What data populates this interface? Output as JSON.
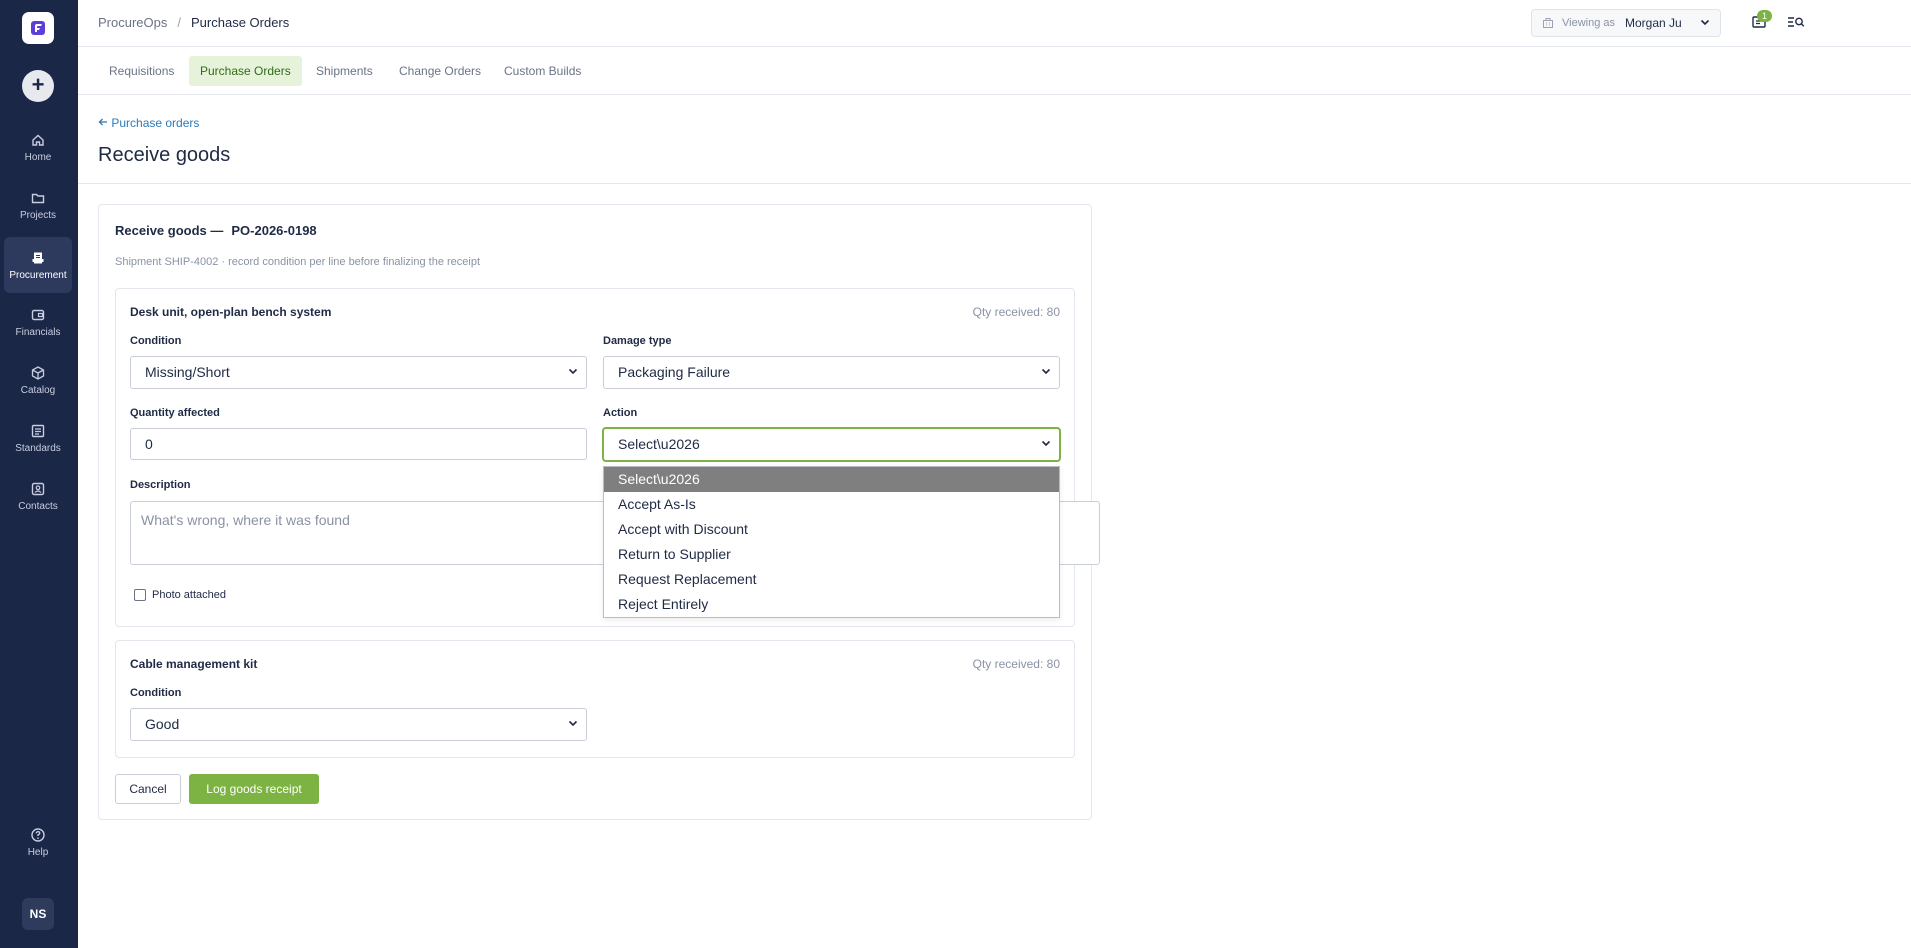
{
  "sidebar": {
    "items": [
      {
        "label": "Home",
        "icon": "home-icon"
      },
      {
        "label": "Projects",
        "icon": "folder-icon"
      },
      {
        "label": "Procurement",
        "icon": "procurement-icon"
      },
      {
        "label": "Financials",
        "icon": "wallet-icon"
      },
      {
        "label": "Catalog",
        "icon": "cube-icon"
      },
      {
        "label": "Standards",
        "icon": "list-icon"
      },
      {
        "label": "Contacts",
        "icon": "contact-card-icon"
      }
    ],
    "help": {
      "label": "Help",
      "icon": "help-icon"
    },
    "user_initials": "NS",
    "active": "Procurement"
  },
  "topbar": {
    "app": "ProcureOps",
    "separator": "/",
    "section": "Purchase Orders",
    "viewing_as_label": "Viewing as",
    "viewing_as_name": "Morgan Ju",
    "notification_count": "1"
  },
  "tabs": [
    {
      "label": "Requisitions",
      "active": false
    },
    {
      "label": "Purchase Orders",
      "active": true
    },
    {
      "label": "Shipments",
      "active": false
    },
    {
      "label": "Change Orders",
      "active": false
    },
    {
      "label": "Custom Builds",
      "active": false
    }
  ],
  "page": {
    "back_link": "Purchase orders",
    "title": "Receive goods"
  },
  "card": {
    "title": "Receive goods —",
    "po_number": "PO-2026-0198",
    "subtitle": "Shipment SHIP-4002 · record condition per line before finalizing the receipt",
    "lines": [
      {
        "name": "Desk unit, open-plan bench system",
        "qty_received": "Qty received: 80",
        "condition_label": "Condition",
        "condition_value": "Missing/Short",
        "damage_label": "Damage type",
        "damage_value": "Packaging Failure",
        "quantity_label": "Quantity affected",
        "quantity_value": "0",
        "action_label": "Action",
        "action_value": "Select\\u2026",
        "description_label": "Description",
        "description_placeholder": "What's wrong, where it was found",
        "photo_label": "Photo attached"
      },
      {
        "name": "Cable management kit",
        "qty_received": "Qty received: 80",
        "condition_label": "Condition",
        "condition_value": "Good"
      }
    ],
    "action_options": [
      "Select\\u2026",
      "Accept As-Is",
      "Accept with Discount",
      "Return to Supplier",
      "Request Replacement",
      "Reject Entirely"
    ],
    "cancel_label": "Cancel",
    "submit_label": "Log goods receipt"
  },
  "colors": {
    "sidebar_bg": "#1b2747",
    "accent_green": "#7cb342",
    "link_blue": "#2b7bb9"
  }
}
